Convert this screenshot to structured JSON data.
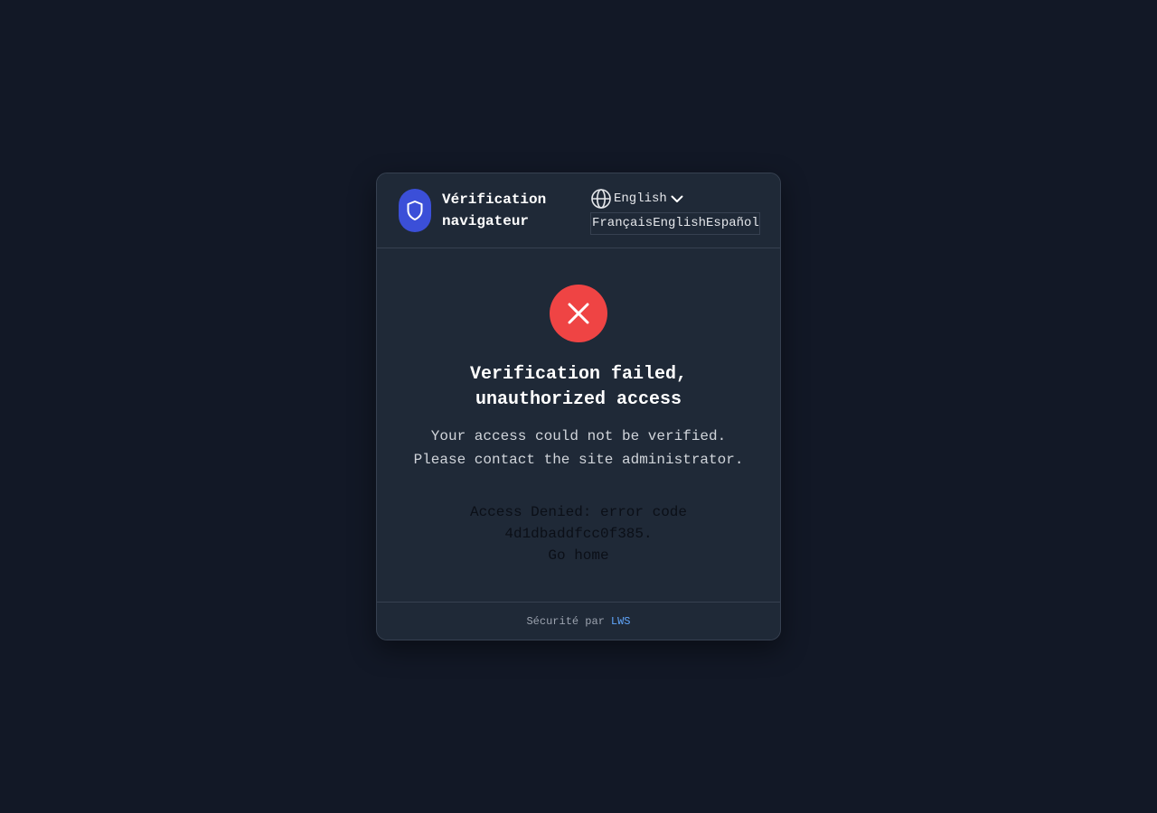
{
  "brand": {
    "line1": "Vérification",
    "line2": "navigateur",
    "logo_icon": "shield-icon",
    "logo_color": "#3b4fd8"
  },
  "language": {
    "current": "English",
    "globe_icon": "globe-icon",
    "chevron_icon": "chevron-down-icon",
    "options": [
      "Français",
      "English",
      "Español"
    ]
  },
  "status": {
    "icon": "close-icon",
    "icon_color": "#ef4444",
    "title": "Verification failed, unauthorized access",
    "message_line1": "Your access could not be verified.",
    "message_line2": "Please contact the site administrator.",
    "denied_line1": "Access Denied: error code",
    "denied_line2": "4d1dbaddfcc0f385.",
    "home_link": "Go home"
  },
  "footer": {
    "prefix": "Sécurité par",
    "provider": "LWS",
    "link_color": "#60a5fa"
  },
  "colors": {
    "background": "#121826",
    "card": "#1f2937",
    "border": "#374151"
  }
}
